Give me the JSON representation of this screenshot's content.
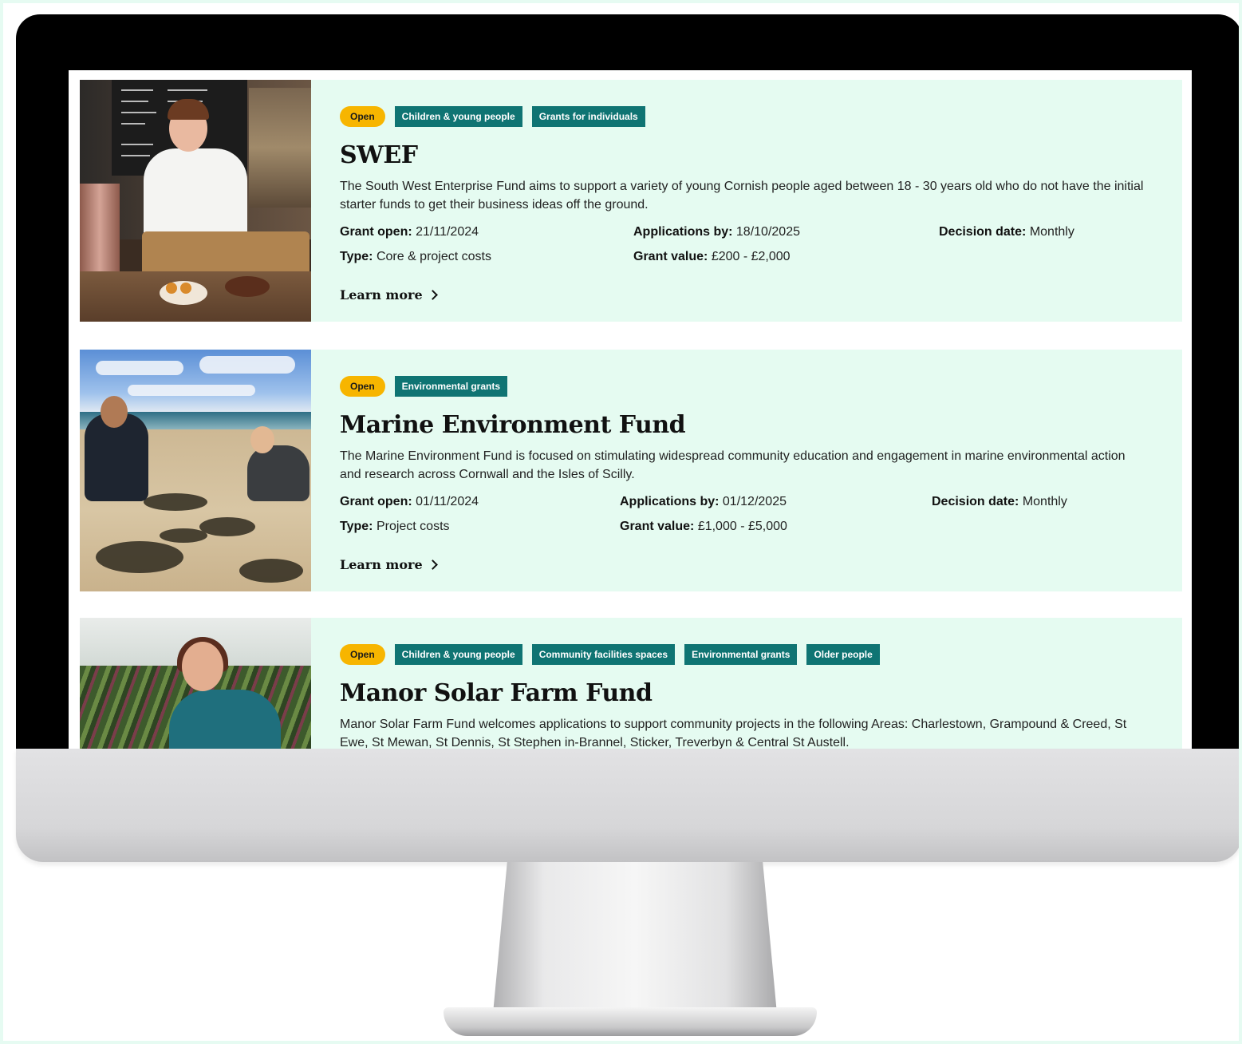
{
  "grants": [
    {
      "status": "Open",
      "tags": [
        "Children & young people",
        "Grants for individuals"
      ],
      "title": "SWEF",
      "description": "The South West Enterprise Fund aims to support a variety of young Cornish people aged between 18 - 30 years old who do not have the initial starter funds to get their business ideas off the ground.",
      "grant_open_label": "Grant open:",
      "grant_open": "21/11/2024",
      "applications_label": "Applications by:",
      "applications_by": "18/10/2025",
      "decision_label": "Decision date:",
      "decision_date": "Monthly",
      "type_label": "Type:",
      "type": "Core & project costs",
      "value_label": "Grant value:",
      "grant_value": "£200 - £2,000",
      "learn_more": "Learn more"
    },
    {
      "status": "Open",
      "tags": [
        "Environmental grants"
      ],
      "title": "Marine Environment Fund",
      "description": "The Marine Environment Fund is focused on stimulating widespread community education and engagement in marine environmental action and research across Cornwall and the Isles of Scilly.",
      "grant_open_label": "Grant open:",
      "grant_open": "01/11/2024",
      "applications_label": "Applications by:",
      "applications_by": "01/12/2025",
      "decision_label": "Decision date:",
      "decision_date": "Monthly",
      "type_label": "Type:",
      "type": "Project costs",
      "value_label": "Grant value:",
      "grant_value": "£1,000 - £5,000",
      "learn_more": "Learn more"
    },
    {
      "status": "Open",
      "tags": [
        "Children & young people",
        "Community facilities spaces",
        "Environmental grants",
        "Older people"
      ],
      "title": "Manor Solar Farm Fund",
      "description": "Manor Solar Farm Fund welcomes applications to support community projects in the following Areas: Charlestown, Grampound & Creed, St Ewe, St Mewan, St Dennis, St Stephen in-Brannel, Sticker, Treverbyn & Central St Austell."
    }
  ]
}
